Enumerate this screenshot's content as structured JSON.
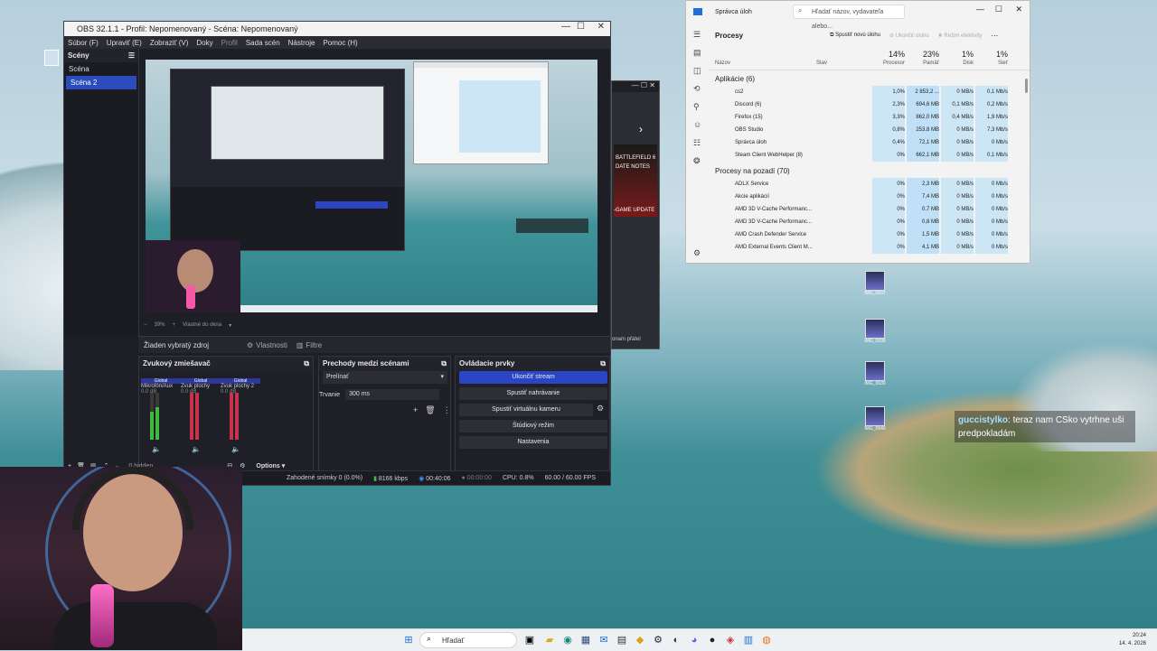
{
  "obs": {
    "title": "OBS 32.1.1 - Profil: Nepomenovaný - Scéna: Nepomenovaný",
    "menu": [
      "Súbor (F)",
      "Upraviť (E)",
      "Zobraziť (V)",
      "Doky",
      "Profil",
      "Sada scén",
      "Nástroje",
      "Pomoc (H)"
    ],
    "scenes_header": "Scény",
    "scenes": [
      "Scéna",
      "Scéna 2"
    ],
    "zoom": "39%",
    "zoom_label": "Vlastné do okna",
    "no_source": "Žiaden vybratý zdroj",
    "properties": "Vlastnosti",
    "filters": "Filtre",
    "mixer_header": "Zvukový zmiešavač",
    "mixer_channels": [
      {
        "global": "Global",
        "name": "Mikrofón/Aux",
        "db": "0.0 dB"
      },
      {
        "global": "Global",
        "name": "Zvuk plochy",
        "db": "0.0 dB"
      },
      {
        "global": "Global",
        "name": "Zvuk plochy 2",
        "db": "0.0 dB"
      }
    ],
    "transitions_header": "Prechody medzi scénami",
    "transition_select": "Prelínať",
    "duration_label": "Trvanie",
    "duration_value": "300 ms",
    "controls_header": "Ovládacie prvky",
    "controls": [
      "Ukončiť stream",
      "Spustiť nahrávanie",
      "Spustiť virtuálnu kameru",
      "Štúdiový režim",
      "Nastavenia"
    ],
    "hidden": "0 hidden",
    "options": "Options",
    "status": {
      "dropped": "Zahodené snímky 0 (0.0%)",
      "bitrate": "8166 kbps",
      "stream_time": "00:40:06",
      "rec_time": "00:00:00",
      "cpu": "CPU: 0.8%",
      "fps": "60.00 / 60.00 FPS"
    }
  },
  "task_manager": {
    "title": "Správca úloh",
    "search_placeholder": "Hľadať názov, vydavateľa alebo...",
    "page": "Procesy",
    "run_new": "Spustiť novú úlohu",
    "end_task": "Ukončiť úlohu",
    "efficiency": "Režim efektivity",
    "col_name": "Názov",
    "col_status": "Stav",
    "cpu_pct": "14%",
    "cpu_label": "Procesor",
    "mem_pct": "23%",
    "mem_label": "Pamäť",
    "disk_pct": "1%",
    "disk_label": "Disk",
    "net_pct": "1%",
    "net_label": "Sieť",
    "apps_group": "Aplikácie (6)",
    "apps": [
      {
        "name": "cs2",
        "cpu": "1,0%",
        "mem": "2 853,2 ...",
        "disk": "0 MB/s",
        "net": "0,1 Mb/s"
      },
      {
        "name": "Discord (6)",
        "cpu": "2,3%",
        "mem": "694,6 MB",
        "disk": "0,1 MB/s",
        "net": "0,2 Mb/s"
      },
      {
        "name": "Firefox (15)",
        "cpu": "3,3%",
        "mem": "862,0 MB",
        "disk": "0,4 MB/s",
        "net": "1,9 Mb/s"
      },
      {
        "name": "OBS Studio",
        "cpu": "0,8%",
        "mem": "253,8 MB",
        "disk": "0 MB/s",
        "net": "7,3 Mb/s"
      },
      {
        "name": "Správca úloh",
        "cpu": "0,4%",
        "mem": "72,1 MB",
        "disk": "0 MB/s",
        "net": "0 Mb/s"
      },
      {
        "name": "Steam Client WebHelper (8)",
        "cpu": "0%",
        "mem": "662,1 MB",
        "disk": "0 MB/s",
        "net": "0,1 Mb/s"
      }
    ],
    "bg_group": "Procesy na pozadí (70)",
    "bg": [
      {
        "name": "ADLX Service",
        "cpu": "0%",
        "mem": "2,3 MB",
        "disk": "0 MB/s",
        "net": "0 Mb/s"
      },
      {
        "name": "Akcie aplikácií",
        "cpu": "0%",
        "mem": "7,4 MB",
        "disk": "0 MB/s",
        "net": "0 Mb/s"
      },
      {
        "name": "AMD 3D V-Cache Performanc...",
        "cpu": "0%",
        "mem": "0,7 MB",
        "disk": "0 MB/s",
        "net": "0 Mb/s"
      },
      {
        "name": "AMD 3D V-Cache Performanc...",
        "cpu": "0%",
        "mem": "0,8 MB",
        "disk": "0 MB/s",
        "net": "0 Mb/s"
      },
      {
        "name": "AMD Crash Defender Service",
        "cpu": "0%",
        "mem": "1,5 MB",
        "disk": "0 MB/s",
        "net": "0 Mb/s"
      },
      {
        "name": "AMD External Events Client M...",
        "cpu": "0%",
        "mem": "4,1 MB",
        "disk": "0 MB/s",
        "net": "0 Mb/s"
      }
    ]
  },
  "win2": {
    "text1": "BATTLEFIELD 6",
    "text2": "DATE NOTES",
    "text3": "-GAME UPDATE",
    "footer": "onam přátel"
  },
  "desktop_icons": [
    "IMG_0637",
    "IMG_0638",
    "IMG_0639",
    "IMG_0640"
  ],
  "chat": {
    "user": "guccistylko",
    "message": ": teraz nam CSko vytrhne uši predpokladám"
  },
  "taskbar": {
    "search": "Hľadať",
    "time": "20:24",
    "date": "14. 4. 2026"
  }
}
